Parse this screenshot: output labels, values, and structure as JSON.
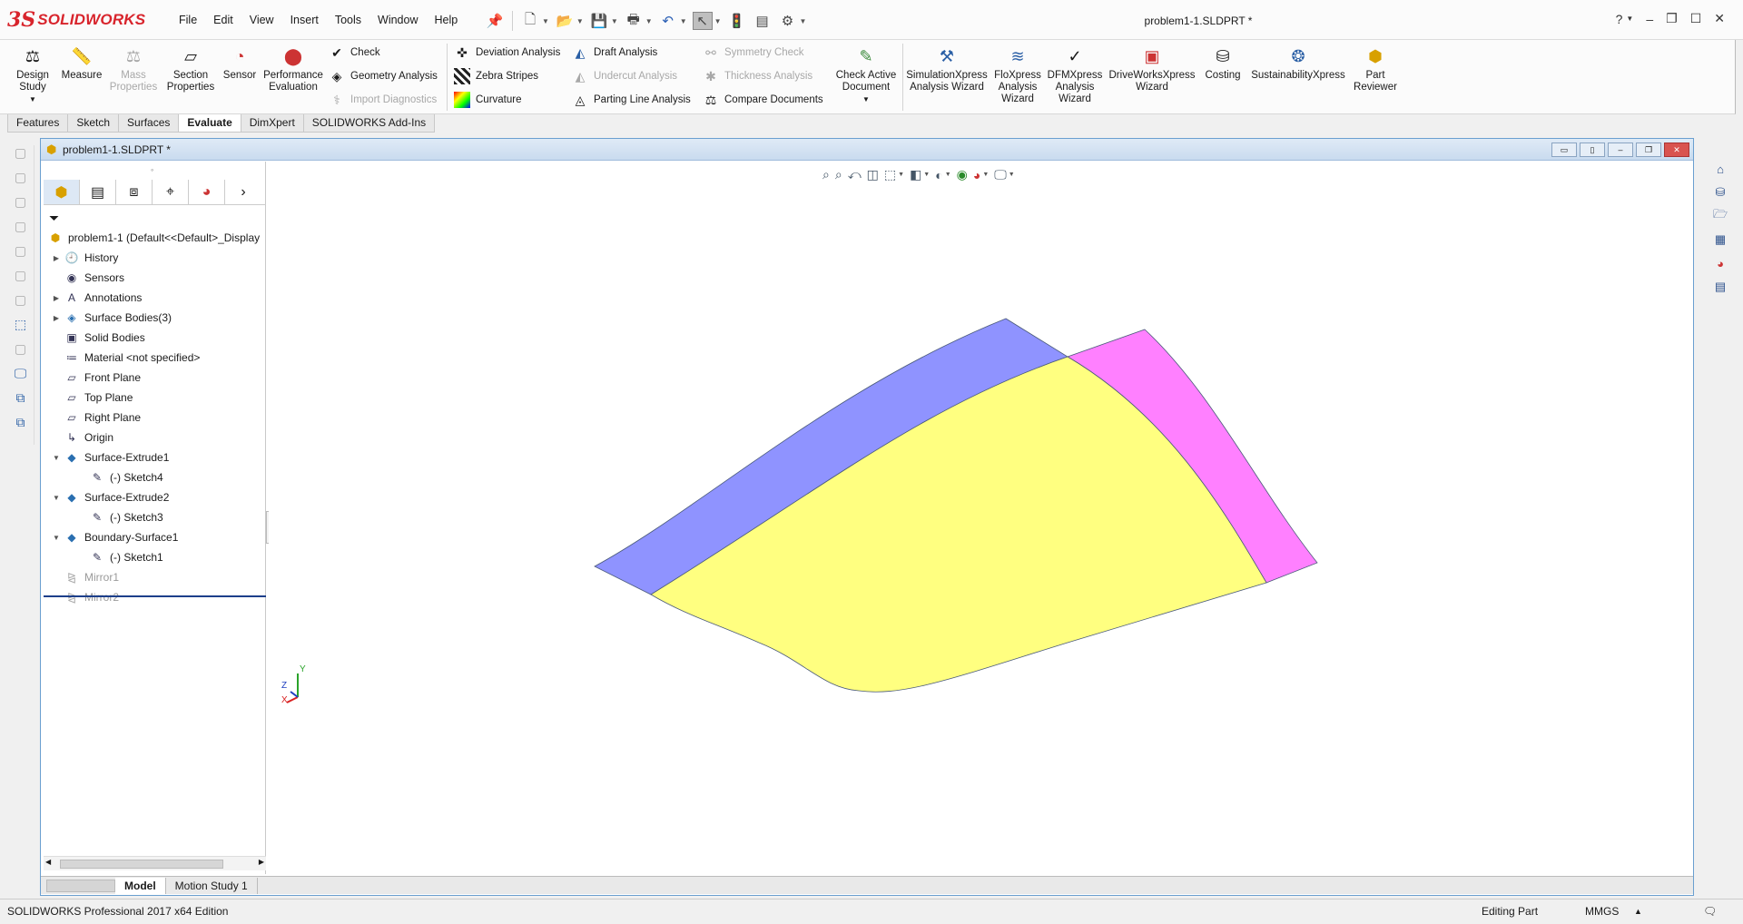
{
  "app": {
    "brand_prefix": "3S",
    "brand": "SOLIDWORKS",
    "doc_title": "problem1-1.SLDPRT *"
  },
  "menu": [
    "File",
    "Edit",
    "View",
    "Insert",
    "Tools",
    "Window",
    "Help"
  ],
  "command_manager": {
    "big_buttons": [
      {
        "label": "Design\nStudy",
        "icon": "design-study-icon",
        "enabled": true
      },
      {
        "label": "Measure",
        "icon": "measure-icon",
        "enabled": true
      },
      {
        "label": "Mass\nProperties",
        "icon": "mass-properties-icon",
        "enabled": false
      },
      {
        "label": "Section\nProperties",
        "icon": "section-properties-icon",
        "enabled": true
      },
      {
        "label": "Sensor",
        "icon": "sensor-icon",
        "enabled": true
      },
      {
        "label": "Performance\nEvaluation",
        "icon": "performance-icon",
        "enabled": true
      }
    ],
    "col1": [
      {
        "label": "Check",
        "icon": "check-icon",
        "enabled": true
      },
      {
        "label": "Geometry Analysis",
        "icon": "geometry-analysis-icon",
        "enabled": true
      },
      {
        "label": "Import Diagnostics",
        "icon": "import-diagnostics-icon",
        "enabled": false
      }
    ],
    "col2": [
      {
        "label": "Deviation Analysis",
        "icon": "deviation-analysis-icon",
        "enabled": true
      },
      {
        "label": "Zebra Stripes",
        "icon": "zebra-stripes-icon",
        "enabled": true
      },
      {
        "label": "Curvature",
        "icon": "curvature-icon",
        "enabled": true
      }
    ],
    "col3": [
      {
        "label": "Draft Analysis",
        "icon": "draft-analysis-icon",
        "enabled": true
      },
      {
        "label": "Undercut Analysis",
        "icon": "undercut-analysis-icon",
        "enabled": false
      },
      {
        "label": "Parting Line Analysis",
        "icon": "parting-line-icon",
        "enabled": true
      }
    ],
    "col4": [
      {
        "label": "Symmetry Check",
        "icon": "symmetry-check-icon",
        "enabled": false
      },
      {
        "label": "Thickness Analysis",
        "icon": "thickness-analysis-icon",
        "enabled": false
      },
      {
        "label": "Compare Documents",
        "icon": "compare-documents-icon",
        "enabled": true
      }
    ],
    "check_active": "Check Active\nDocument",
    "xpress": [
      {
        "label": "SimulationXpress\nAnalysis Wizard",
        "icon": "simulationxpress-icon"
      },
      {
        "label": "FloXpress\nAnalysis\nWizard",
        "icon": "floxpress-icon"
      },
      {
        "label": "DFMXpress\nAnalysis\nWizard",
        "icon": "dfmxpress-icon"
      },
      {
        "label": "DriveWorksXpress\nWizard",
        "icon": "driveworksxpress-icon"
      },
      {
        "label": "Costing",
        "icon": "costing-icon"
      },
      {
        "label": "SustainabilityXpress",
        "icon": "sustainability-icon"
      },
      {
        "label": "Part\nReviewer",
        "icon": "part-reviewer-icon"
      }
    ]
  },
  "cm_tabs": [
    "Features",
    "Sketch",
    "Surfaces",
    "Evaluate",
    "DimXpert",
    "SOLIDWORKS Add-Ins"
  ],
  "active_cm_tab": "Evaluate",
  "doc_window": {
    "title": "problem1-1.SLDPRT *"
  },
  "feature_tree": [
    {
      "label": "problem1-1  (Default<<Default>_Display",
      "icon": "part-icon",
      "expander": "",
      "indent": 0,
      "grey": false
    },
    {
      "label": "History",
      "icon": "history-icon",
      "expander": "▶",
      "indent": 1,
      "grey": false
    },
    {
      "label": "Sensors",
      "icon": "sensors-icon",
      "expander": "",
      "indent": 1,
      "grey": false
    },
    {
      "label": "Annotations",
      "icon": "annotations-icon",
      "expander": "▶",
      "indent": 1,
      "grey": false
    },
    {
      "label": "Surface Bodies(3)",
      "icon": "surface-bodies-icon",
      "expander": "▶",
      "indent": 1,
      "grey": false
    },
    {
      "label": "Solid Bodies",
      "icon": "solid-bodies-icon",
      "expander": "",
      "indent": 1,
      "grey": false
    },
    {
      "label": "Material <not specified>",
      "icon": "material-icon",
      "expander": "",
      "indent": 1,
      "grey": false
    },
    {
      "label": "Front Plane",
      "icon": "plane-icon",
      "expander": "",
      "indent": 1,
      "grey": false
    },
    {
      "label": "Top Plane",
      "icon": "plane-icon",
      "expander": "",
      "indent": 1,
      "grey": false
    },
    {
      "label": "Right Plane",
      "icon": "plane-icon",
      "expander": "",
      "indent": 1,
      "grey": false
    },
    {
      "label": "Origin",
      "icon": "origin-icon",
      "expander": "",
      "indent": 1,
      "grey": false
    },
    {
      "label": "Surface-Extrude1",
      "icon": "surface-extrude-icon",
      "expander": "▼",
      "indent": 1,
      "grey": false
    },
    {
      "label": "(-) Sketch4",
      "icon": "sketch-icon",
      "expander": "",
      "indent": 2,
      "grey": false
    },
    {
      "label": "Surface-Extrude2",
      "icon": "surface-extrude-icon",
      "expander": "▼",
      "indent": 1,
      "grey": false
    },
    {
      "label": "(-) Sketch3",
      "icon": "sketch-icon",
      "expander": "",
      "indent": 2,
      "grey": false
    },
    {
      "label": "Boundary-Surface1",
      "icon": "boundary-surface-icon",
      "expander": "▼",
      "indent": 1,
      "grey": false
    },
    {
      "label": "(-) Sketch1",
      "icon": "sketch-icon",
      "expander": "",
      "indent": 2,
      "grey": false
    },
    {
      "label": "Mirror1",
      "icon": "mirror-icon",
      "expander": "",
      "indent": 1,
      "grey": true
    },
    {
      "label": "Mirror2",
      "icon": "mirror-icon",
      "expander": "",
      "indent": 1,
      "grey": true
    }
  ],
  "bottom_tabs": [
    "Model",
    "Motion Study 1"
  ],
  "triad": {
    "x": "X",
    "y": "Y",
    "z": "Z"
  },
  "colors": {
    "surface_blue": "#8f93ff",
    "surface_yellow": "#ffff80",
    "surface_magenta": "#ff80ff",
    "edge": "#4a5a7a"
  },
  "status": {
    "product": "SOLIDWORKS Professional 2017 x64 Edition",
    "mode": "Editing Part",
    "units": "MMGS"
  }
}
